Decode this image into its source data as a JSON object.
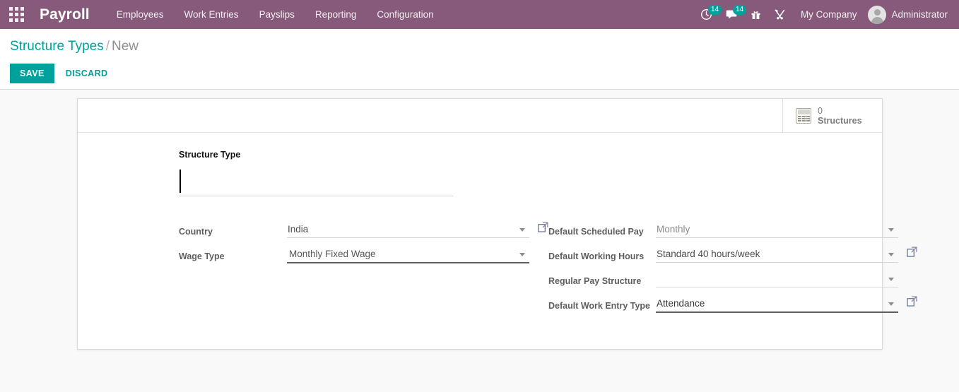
{
  "navbar": {
    "apps_icon": "apps-grid-icon",
    "brand": "Payroll",
    "menu_items": [
      {
        "label": "Employees"
      },
      {
        "label": "Work Entries"
      },
      {
        "label": "Payslips"
      },
      {
        "label": "Reporting"
      },
      {
        "label": "Configuration"
      }
    ],
    "systray": {
      "activity_icon": "clock-activity-icon",
      "activity_count": "14",
      "messaging_icon": "chat-bubble-icon",
      "messaging_count": "14",
      "gift_icon": "gift-icon",
      "tools_icon": "tools-icon"
    },
    "company": "My Company",
    "user": "Administrator",
    "avatar_icon": "user-avatar-icon",
    "accent_color": "#875A7B",
    "badge_color": "#00A09D"
  },
  "control_panel": {
    "breadcrumb": {
      "parent": "Structure Types",
      "separator": "/",
      "current": "New"
    },
    "save_label": "SAVE",
    "discard_label": "DISCARD",
    "save_color": "#00A09D"
  },
  "stat_button": {
    "icon": "calculator-icon",
    "value": "0",
    "label": "Structures"
  },
  "form": {
    "name_label": "Structure Type",
    "name_value": "",
    "name_placeholder": "",
    "left_fields": [
      {
        "label": "Country",
        "value": "India",
        "placeholder": "",
        "has_external_link": true,
        "focused": false,
        "state": "filled"
      },
      {
        "label": "Wage Type",
        "value": "Monthly Fixed Wage",
        "placeholder": "",
        "has_external_link": false,
        "focused": true,
        "state": "focused"
      }
    ],
    "right_fields": [
      {
        "label": "Default Scheduled Pay",
        "value": "Monthly",
        "placeholder": "",
        "has_external_link": false,
        "focused": false,
        "state": "muted"
      },
      {
        "label": "Default Working Hours",
        "value": "Standard 40 hours/week",
        "placeholder": "",
        "has_external_link": true,
        "focused": false,
        "state": "filled"
      },
      {
        "label": "Regular Pay Structure",
        "value": "",
        "placeholder": "",
        "has_external_link": false,
        "focused": false,
        "state": "empty"
      },
      {
        "label": "Default Work Entry Type",
        "value": "Attendance",
        "placeholder": "",
        "has_external_link": true,
        "focused": false,
        "state": "selected"
      }
    ],
    "dropdown_icon": "chevron-down-icon",
    "external_link_icon": "external-link-icon"
  }
}
